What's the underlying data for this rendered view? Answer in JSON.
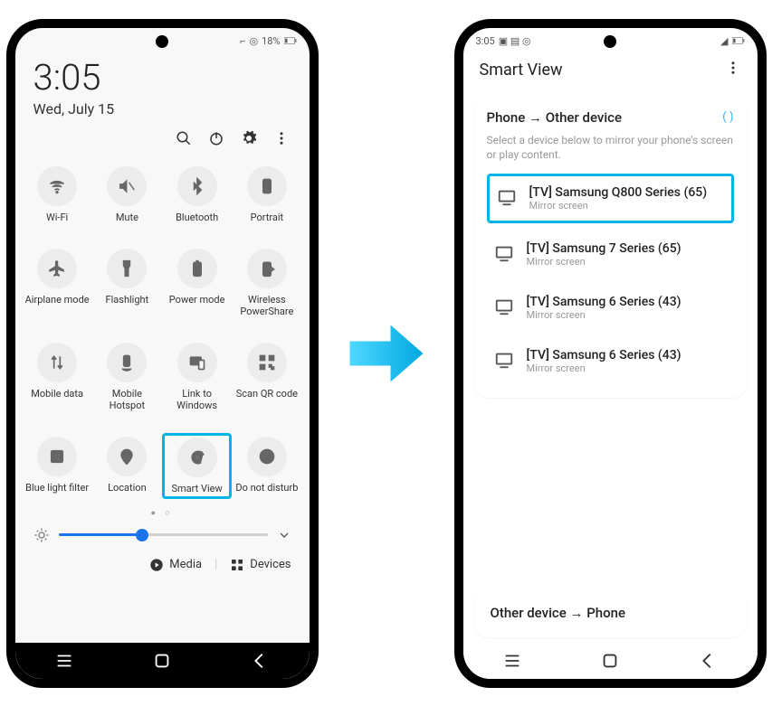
{
  "left": {
    "status": {
      "battery": "18%",
      "vibrate": "⌐",
      "signal": "◎"
    },
    "clock": {
      "time": "3:05",
      "date": "Wed, July 15"
    },
    "tiles": [
      {
        "id": "wifi",
        "label": "Wi-Fi"
      },
      {
        "id": "mute",
        "label": "Mute"
      },
      {
        "id": "bluetooth",
        "label": "Bluetooth"
      },
      {
        "id": "portrait",
        "label": "Portrait"
      },
      {
        "id": "airplane",
        "label": "Airplane mode"
      },
      {
        "id": "flashlight",
        "label": "Flashlight"
      },
      {
        "id": "power",
        "label": "Power mode"
      },
      {
        "id": "wireless-powershare",
        "label": "Wireless PowerShare"
      },
      {
        "id": "mobile-data",
        "label": "Mobile data"
      },
      {
        "id": "mobile-hotspot",
        "label": "Mobile Hotspot"
      },
      {
        "id": "link-to-windows",
        "label": "Link to Windows"
      },
      {
        "id": "scan-qr",
        "label": "Scan QR code"
      },
      {
        "id": "blue-light",
        "label": "Blue light filter"
      },
      {
        "id": "location",
        "label": "Location"
      },
      {
        "id": "smart-view",
        "label": "Smart View",
        "highlight": true
      },
      {
        "id": "dnd",
        "label": "Do not disturb"
      }
    ],
    "footer": {
      "media": "Media",
      "devices": "Devices"
    }
  },
  "right": {
    "status_time": "3:05",
    "title": "Smart View",
    "card_title": "Phone → Other device",
    "card_sub": "Select a device below to mirror your phone's screen or play content.",
    "devices": [
      {
        "name": "[TV] Samsung Q800 Series (65)",
        "sub": "Mirror screen",
        "highlight": true
      },
      {
        "name": "[TV] Samsung 7 Series (65)",
        "sub": "Mirror screen"
      },
      {
        "name": "[TV] Samsung 6 Series (43)",
        "sub": "Mirror screen"
      },
      {
        "name": "[TV] Samsung 6 Series (43)",
        "sub": "Mirror screen"
      }
    ],
    "bottom_card": "Other device → Phone"
  }
}
